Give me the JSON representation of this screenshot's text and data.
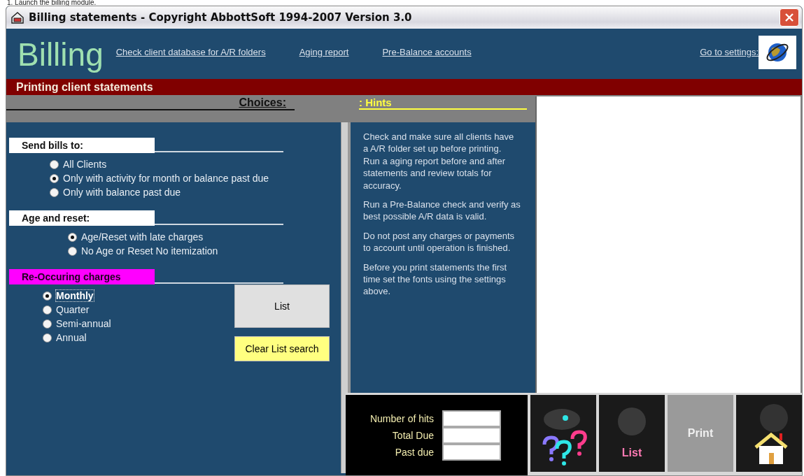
{
  "caption": "1.    Launch the billing module.",
  "window": {
    "title": "Billing statements - Copyright AbbottSoft 1994-2007 Version 3.0"
  },
  "header": {
    "logo": "Billing",
    "links": [
      "Check client database for A/R folders",
      "Aging report",
      "Pre-Balance accounts"
    ],
    "settings_link": "Go to settings:"
  },
  "banner": "Printing client statements",
  "choices_heading": "Choices:",
  "hints_heading": ": Hints",
  "groups": [
    {
      "title": "Send bills to:",
      "highlight": false,
      "options": [
        {
          "label": "All Clients",
          "selected": false,
          "focused": false
        },
        {
          "label": "Only with activity for month or balance past due",
          "selected": true,
          "focused": false
        },
        {
          "label": "Only with balance past due",
          "selected": false,
          "focused": false
        }
      ]
    },
    {
      "title": "Age and reset:",
      "highlight": false,
      "options": [
        {
          "label": "Age/Reset with late charges",
          "selected": true,
          "focused": false
        },
        {
          "label": "No Age or Reset No itemization",
          "selected": false,
          "focused": false
        }
      ]
    },
    {
      "title": "Re-Occuring charges",
      "highlight": true,
      "options": [
        {
          "label": "Monthly",
          "selected": true,
          "focused": true
        },
        {
          "label": "Quarter",
          "selected": false,
          "focused": false
        },
        {
          "label": "Semi-annual",
          "selected": false,
          "focused": false
        },
        {
          "label": "Annual",
          "selected": false,
          "focused": false
        }
      ]
    }
  ],
  "list_button": "List",
  "clear_button": "Clear List search",
  "hints": [
    [
      "Check and make sure all clients have a A/R folder set up before printing.",
      "Run a aging report before and after statements and review totals for accuracy."
    ],
    [
      "Run a Pre-Balance check and verify as best possible A/R data is valid."
    ],
    [
      "Do not post any charges or payments to account until operation is finished."
    ],
    [
      "Before you print statements the first time set the fonts using the settings above."
    ]
  ],
  "stats": [
    "Number of hits",
    "Total Due",
    "Past due"
  ],
  "toolbar": [
    {
      "kind": "help"
    },
    {
      "kind": "list",
      "label": "List"
    },
    {
      "kind": "print",
      "label": "Print"
    },
    {
      "kind": "home"
    }
  ]
}
